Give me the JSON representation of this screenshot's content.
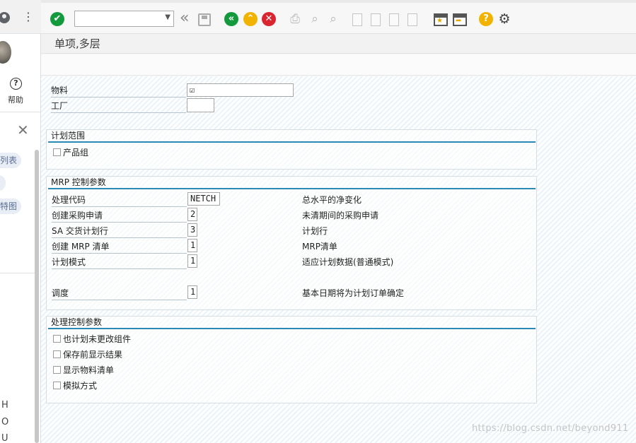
{
  "sidebar": {
    "kebab": "⋮",
    "help_label": "帮助",
    "help_glyph": "?",
    "close_glyph": "✕",
    "pill_1": "列表",
    "pill_3": "特图",
    "letters": [
      "H",
      "O",
      "U"
    ]
  },
  "toolbar": {
    "command_value": "",
    "ok_glyph": "✔",
    "back_glyph": "«",
    "exit_glyph": "⌃",
    "cancel_glyph": "✕",
    "help_glyph": "?",
    "double_chevron": "«"
  },
  "title": "单项,多层",
  "selection": {
    "material_label": "物料",
    "material_value": "☑",
    "plant_label": "工厂",
    "plant_value": ""
  },
  "planning_scope": {
    "title": "计划范围",
    "product_group_label": "产品组"
  },
  "mrp_params": {
    "title": "MRP 控制参数",
    "rows": [
      {
        "label": "处理代码",
        "value": "NETCH",
        "desc": "总水平的净变化"
      },
      {
        "label": "创建采购申请",
        "value": "2",
        "desc": "未清期间的采购申请"
      },
      {
        "label": "SA 交货计划行",
        "value": "3",
        "desc": "计划行"
      },
      {
        "label": "创建 MRP 清单",
        "value": "1",
        "desc": "MRP清单"
      },
      {
        "label": "计划模式",
        "value": "1",
        "desc": "适应计划数据(普通模式)"
      },
      {
        "label": "调度",
        "value": "1",
        "desc": "基本日期将为计划订单确定"
      }
    ]
  },
  "process_control": {
    "title": "处理控制参数",
    "options": [
      "也计划未更改组件",
      "保存前显示结果",
      "显示物料清单",
      "模拟方式"
    ]
  },
  "watermark": "https://blog.csdn.net/beyond911"
}
